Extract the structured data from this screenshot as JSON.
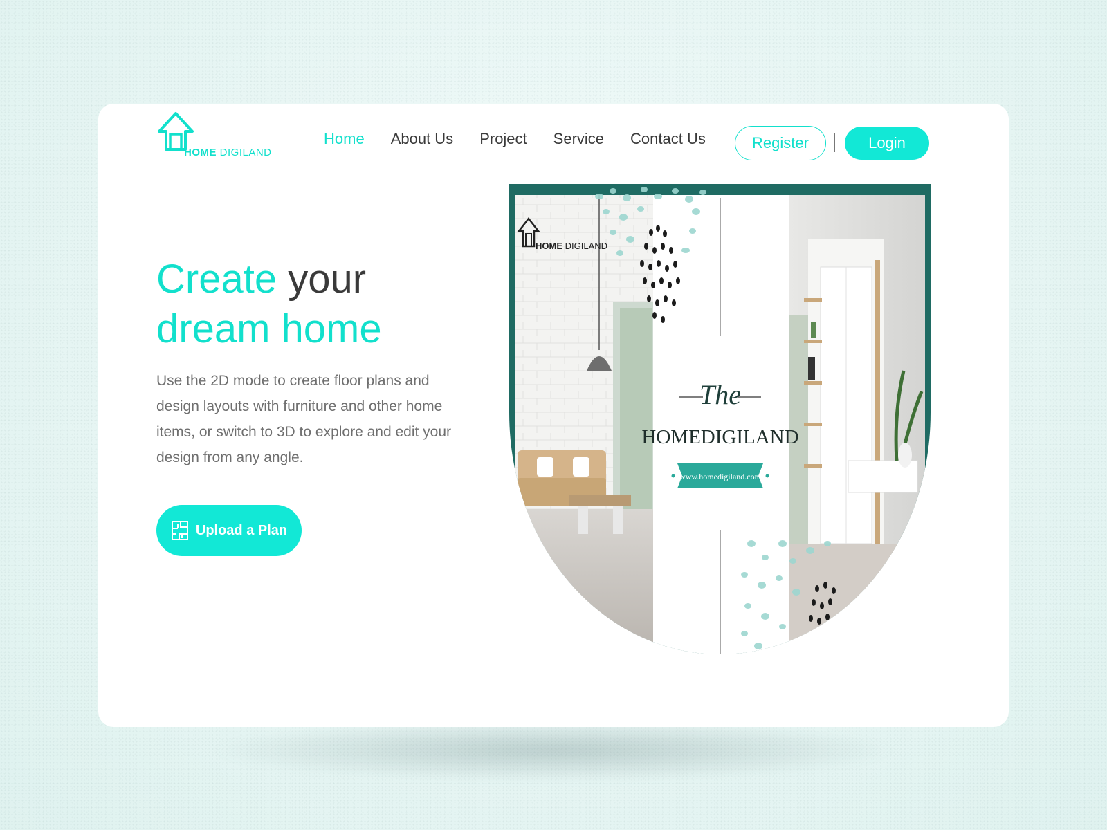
{
  "brand": {
    "name_bold": "HOME",
    "name_rest": " DIGILAND",
    "accent_color": "#12e0cc",
    "logo_icon": "house-arrow-icon"
  },
  "nav": {
    "items": [
      {
        "label": "Home",
        "active": true
      },
      {
        "label": "About Us",
        "active": false
      },
      {
        "label": "Project",
        "active": false
      },
      {
        "label": "Service",
        "active": false
      },
      {
        "label": "Contact Us",
        "active": false
      }
    ],
    "register_label": "Register",
    "login_label": "Login",
    "separator": "|"
  },
  "hero": {
    "title_part1": "Create",
    "title_part2": " your ",
    "title_part3": "dream home",
    "description": "Use the 2D mode to create floor plans and design layouts with furniture and other home items, or switch to 3D to explore and edit your design from any angle.",
    "upload_label": "Upload a Plan",
    "upload_icon": "floor-plan-icon"
  },
  "banner": {
    "logo_bold": "HOME",
    "logo_rest": " DIGILAND",
    "the_text": "The",
    "brand_text": "HOMEDIGILAND",
    "url_text": "www.homedigiland.com",
    "frame_color": "#1f6b63",
    "ribbon_color": "#2aa99a"
  }
}
